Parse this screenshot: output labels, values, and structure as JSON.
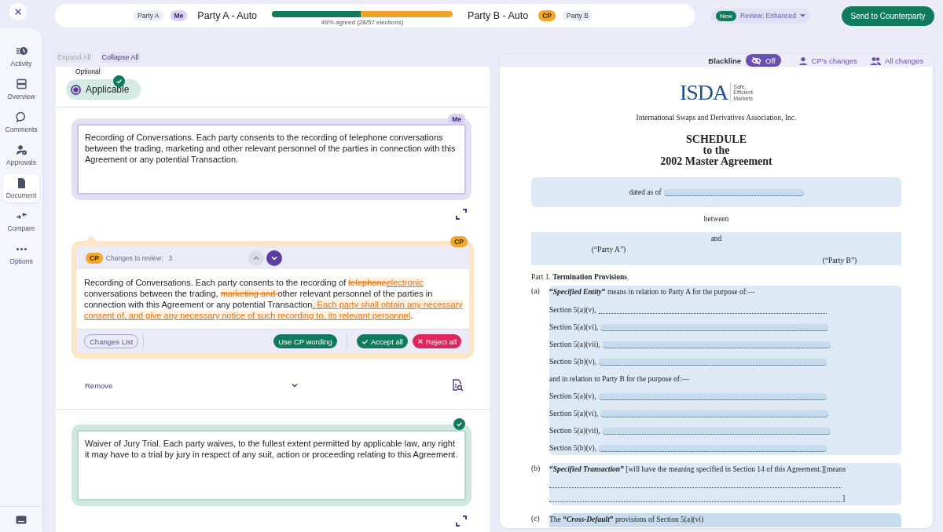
{
  "header": {
    "party_a": {
      "tag": "Party A",
      "badge": "Me",
      "name": "Party A - Auto"
    },
    "progress": {
      "level": 0.49,
      "caption": "49% agreed (28/57 elections)"
    },
    "party_b": {
      "name": "Party B - Auto",
      "badge": "CP",
      "tag": "Party B"
    }
  },
  "review_mode": {
    "badge": "New",
    "label": "Review: Enhanced"
  },
  "send_button": "Send to Counterparty",
  "sidebar": {
    "items": [
      {
        "label": "Activity",
        "kind": "activity",
        "selected": false
      },
      {
        "label": "Overview",
        "kind": "overview",
        "selected": false
      },
      {
        "label": "Comments",
        "kind": "comments",
        "selected": false
      },
      {
        "label": "Approvals",
        "kind": "approvals",
        "selected": false
      },
      {
        "label": "Document",
        "kind": "document",
        "selected": true
      },
      {
        "label": "Compare",
        "kind": "compare",
        "selected": false
      },
      {
        "label": "Options",
        "kind": "options",
        "selected": false
      }
    ]
  },
  "toolbar": [
    {
      "label": "Expand All",
      "disabled": true
    },
    {
      "label": "Collapse All",
      "disabled": false
    }
  ],
  "election": {
    "tag": "Optional",
    "option": "Applicable",
    "selected": true,
    "agreed": true
  },
  "my_wording": {
    "badge": "Me",
    "text": "Recording of Conversations. Each party consents to the recording of telephone conversations between the trading, marketing and other relevant personnel of the parties in connection with this Agreement or any potential Transaction."
  },
  "cp_review": {
    "badge": "CP",
    "header_badge": "CP",
    "changes_label": "Changes to review:",
    "changes_count": "3",
    "nav": [
      {
        "kind": "up",
        "disabled": true
      },
      {
        "kind": "down",
        "disabled": false
      }
    ],
    "segments": [
      {
        "kind": "plain",
        "text": "Recording of Conversations. Each party consents to the recording of "
      },
      {
        "kind": "deleted",
        "text": "telephone"
      },
      {
        "kind": "inserted",
        "text": "electronic"
      },
      {
        "kind": "plain",
        "text": " conversations between the trading, "
      },
      {
        "kind": "deleted",
        "text": "marketing and "
      },
      {
        "kind": "plain",
        "text": "other relevant personnel of the parties in connection with this Agreement or any potential Transaction"
      },
      {
        "kind": "inserted",
        "text": ", Each party shall obtain any necessary consent of, and give any necessary notice of such recording to, its relevant personnel"
      },
      {
        "kind": "plain",
        "text": "."
      }
    ],
    "buttons": [
      {
        "label": "Changes List",
        "kind": "outline"
      },
      {
        "label": "Use CP wording",
        "kind": "primary"
      },
      {
        "label": "Accept all",
        "kind": "accept"
      },
      {
        "label": "Reject all",
        "kind": "reject"
      }
    ]
  },
  "remove_row": {
    "label": "Remove"
  },
  "next_clause": {
    "agreed": true,
    "text": "Waiver of Jury Trial. Each party waives, to the fullest extent permitted by applicable law, any right it may have to a trial by jury in respect of any suit, action or proceeding relating to this Agreement."
  },
  "blackline": {
    "label": "Blackline",
    "toggle": "Off",
    "on": false,
    "options": [
      {
        "label": "CP's changes",
        "kind": "person"
      },
      {
        "label": "All changes",
        "kind": "group"
      }
    ]
  },
  "document": {
    "logo": {
      "mark": "ISDA",
      "tagline": [
        "Safe,",
        "Efficient",
        "Markets"
      ]
    },
    "association": "International Swaps and Derivatives Association, Inc.",
    "title": [
      "SCHEDULE",
      "to the",
      "2002 Master Agreement"
    ],
    "dated": {
      "label": "dated as of",
      "highlighted": true
    },
    "between": "between",
    "and": "and",
    "party_a": "(“Party A”)",
    "party_b": "(“Party B”)",
    "part": "Part 1. **Termination Provisions**.",
    "items": [
      {
        "mark": "(a)",
        "text": "**“*Specified Entity*”** means in relation to Party A for the purpose of:—",
        "rows": [
          {
            "kind": "fill",
            "label": "Section 5(a)(v),",
            "highlighted": false
          },
          {
            "kind": "fill",
            "label": "Section 5(a)(vi),",
            "highlighted": true
          },
          {
            "kind": "fill",
            "label": "Section 5(a)(vii),",
            "highlighted": true
          },
          {
            "kind": "fill",
            "label": "Section 5(b)(v),",
            "highlighted": true
          },
          {
            "kind": "text",
            "text": "and in relation to Party B for the purpose of:—"
          },
          {
            "kind": "fill",
            "label": "Section 5(a)(v),",
            "highlighted": true
          },
          {
            "kind": "fill",
            "label": "Section 5(a)(vi),",
            "highlighted": true
          },
          {
            "kind": "fill",
            "label": "Section 5(a)(vii),",
            "highlighted": true
          },
          {
            "kind": "fill",
            "label": "Section 5(b)(v),",
            "highlighted": true
          }
        ]
      },
      {
        "mark": "(b)",
        "text": "**“*Specified Transaction*”** [will have the meaning specified in Section 14 of this Agreement.][means",
        "rows": [
          {
            "kind": "fill",
            "highlighted": false
          },
          {
            "kind": "fill",
            "highlighted": false,
            "suffix": "]"
          }
        ]
      },
      {
        "mark": "(c)",
        "text": "The **“*Cross-Default*”** provisions of Section 5(a)(vi)"
      }
    ]
  }
}
